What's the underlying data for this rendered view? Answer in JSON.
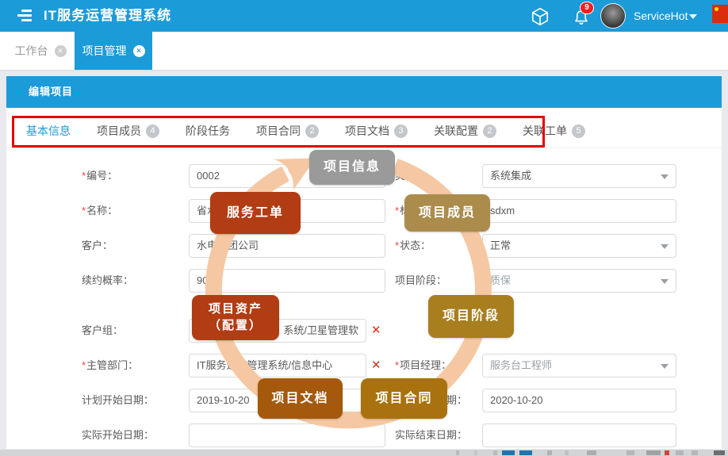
{
  "colors": {
    "primary": "#1b9bd8",
    "ring": "#f5c8a3",
    "annotation_red": "#e60000",
    "badge_gray": "#9a9a9a",
    "badge_rust": "#b23c13",
    "badge_tan": "#ab8c4c",
    "badge_gold": "#a87e1e",
    "badge_amber": "#a4590c",
    "badge_amber2": "#a9720e"
  },
  "header": {
    "title": "IT服务运营管理系统",
    "user": "ServiceHot",
    "notification_count": "9"
  },
  "window_tabs": [
    {
      "label": "工作台",
      "active": false
    },
    {
      "label": "项目管理",
      "active": true
    }
  ],
  "panel": {
    "title": "编辑项目"
  },
  "form_tabs": [
    {
      "label": "基本信息",
      "badge": "",
      "active": true
    },
    {
      "label": "项目成员",
      "badge": "4",
      "active": false
    },
    {
      "label": "阶段任务",
      "badge": "",
      "active": false
    },
    {
      "label": "项目合同",
      "badge": "2",
      "active": false
    },
    {
      "label": "项目文档",
      "badge": "3",
      "active": false
    },
    {
      "label": "关联配置",
      "badge": "2",
      "active": false
    },
    {
      "label": "关联工单",
      "badge": "5",
      "active": false
    }
  ],
  "form": {
    "left_rows": [
      {
        "name": "code",
        "label": "编号",
        "required": true,
        "type": "text",
        "value": "0002"
      },
      {
        "name": "project-name",
        "label": "名称",
        "required": true,
        "type": "text",
        "value": "省水"
      },
      {
        "name": "customer",
        "label": "客户",
        "required": false,
        "type": "text",
        "value": "水电集团公司"
      },
      {
        "name": "renewal-probability",
        "label": "续约概率",
        "required": false,
        "type": "text",
        "value": "90"
      },
      {
        "name": "customer-group",
        "label": "客户组",
        "required": false,
        "type": "text",
        "value": "系统/卫星管理软",
        "clearable": true,
        "narrow": true,
        "align": "right"
      },
      {
        "name": "department",
        "label": "主管部门",
        "required": true,
        "type": "text",
        "value": "IT服务运营管理系统/信息中心",
        "clearable": true,
        "narrow": true
      },
      {
        "name": "plan-start-date",
        "label": "计划开始日期",
        "required": false,
        "type": "text",
        "value": "2019-10-20"
      },
      {
        "name": "actual-start-date",
        "label": "实际开始日期",
        "required": false,
        "type": "text",
        "value": ""
      }
    ],
    "right_rows": [
      {
        "name": "type",
        "label": "类型",
        "required": false,
        "type": "select",
        "value": "系统集成"
      },
      {
        "name": "identifier",
        "label": "标识",
        "required": true,
        "type": "text",
        "value": "sdxm"
      },
      {
        "name": "status",
        "label": "状态",
        "required": true,
        "type": "select",
        "value": "正常"
      },
      {
        "name": "phase",
        "label": "项目阶段",
        "required": false,
        "type": "select",
        "value": "质保",
        "muted": true
      },
      {
        "name": "manager",
        "label": "项目经理",
        "required": true,
        "type": "select",
        "value": "服务台工程师",
        "muted": true
      },
      {
        "name": "plan-end-date",
        "label": "计划结束日期",
        "required": false,
        "type": "text",
        "value": "2020-10-20"
      },
      {
        "name": "actual-end-date",
        "label": "实际结束日期",
        "required": false,
        "type": "text",
        "value": ""
      }
    ]
  },
  "overlay_badges": [
    {
      "name": "project-info",
      "label": "项目信息",
      "color_key": "badge_gray"
    },
    {
      "name": "service-ticket",
      "label": "服务工单",
      "color_key": "badge_rust"
    },
    {
      "name": "project-members",
      "label": "项目成员",
      "color_key": "badge_tan"
    },
    {
      "name": "project-assets",
      "label": "项目资产\n（配置）",
      "color_key": "badge_rust"
    },
    {
      "name": "project-phase",
      "label": "项目阶段",
      "color_key": "badge_gold"
    },
    {
      "name": "project-docs",
      "label": "项目文档",
      "color_key": "badge_amber"
    },
    {
      "name": "project-contract",
      "label": "项目合同",
      "color_key": "badge_amber2"
    }
  ]
}
